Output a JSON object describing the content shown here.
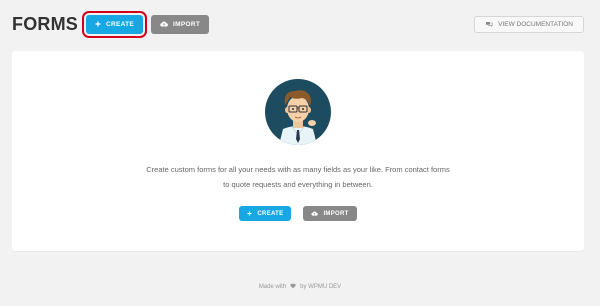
{
  "header": {
    "title": "FORMS",
    "create_label": "CREATE",
    "import_label": "IMPORT",
    "docs_label": "VIEW DOCUMENTATION"
  },
  "main": {
    "message_line1": "Create custom forms for all your needs with as many fields as your like. From contact forms",
    "message_line2": "to quote requests and everything in between.",
    "create_label": "CREATE",
    "import_label": "IMPORT"
  },
  "footer": {
    "made_with": "Made with",
    "by": "by WPMU DEV"
  },
  "icons": {
    "plus": "plus-icon",
    "cloud": "cloud-upload-icon",
    "docs": "chat-bubble-icon",
    "heart": "heart-icon"
  },
  "colors": {
    "primary": "#17a8e3",
    "secondary": "#888888",
    "highlight": "#d0021b"
  }
}
